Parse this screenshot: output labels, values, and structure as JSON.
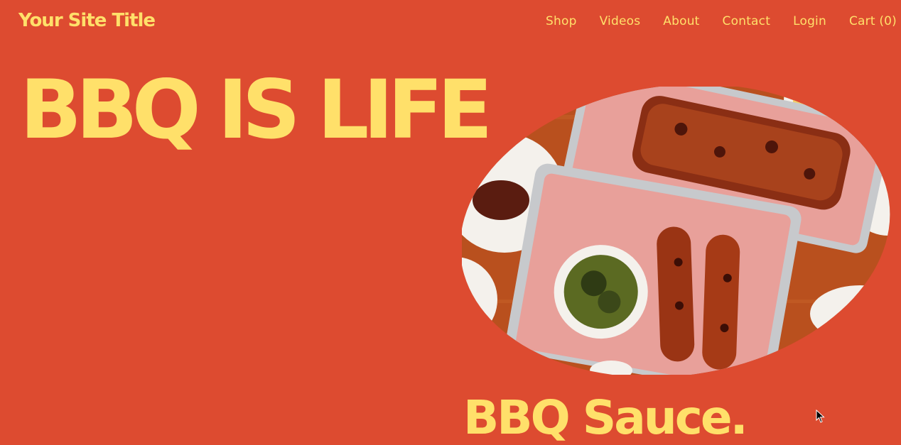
{
  "header": {
    "site_title": "Your Site Title",
    "nav": [
      "Shop",
      "Videos",
      "About",
      "Contact",
      "Login",
      "Cart (0)"
    ]
  },
  "hero": {
    "title": "BBQ IS LIFE",
    "subtitle": "BBQ Sauce."
  },
  "colors": {
    "background": "#dd4b30",
    "accent_text": "#ffe06a"
  },
  "icons": {
    "cursor": "arrow-cursor-icon"
  }
}
